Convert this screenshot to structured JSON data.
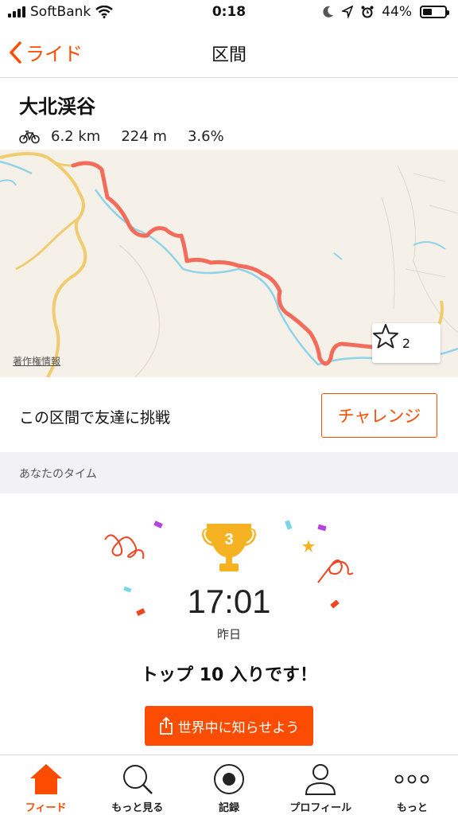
{
  "status_bar": {
    "carrier": "SoftBank",
    "time": "0:18",
    "battery_percent_text": "44%",
    "battery_level": 0.44
  },
  "nav": {
    "back_label": "ライド",
    "title": "区間"
  },
  "segment": {
    "name": "大北渓谷",
    "distance": "6.2 km",
    "elevation": "224 m",
    "grade": "3.6%",
    "activity_icon": "bicycle-icon"
  },
  "map": {
    "copyright": "著作権情報",
    "star_count": "2",
    "route_color": "#f26b5b",
    "road_color": "#f0cc6e",
    "river_color": "#8fd3ea"
  },
  "challenge": {
    "text": "この区間で友達に挑戦",
    "button_label": "チャレンジ"
  },
  "your_time": {
    "header": "あなたのタイム",
    "rank": "3",
    "time": "17:01",
    "date": "昨日",
    "message": "トップ 10 入りです！",
    "share_label": "世界中に知らせよう"
  },
  "tabs": [
    {
      "label": "フィード",
      "icon": "home-icon",
      "active": true
    },
    {
      "label": "もっと見る",
      "icon": "search-icon",
      "active": false
    },
    {
      "label": "記録",
      "icon": "record-icon",
      "active": false
    },
    {
      "label": "プロフィール",
      "icon": "profile-icon",
      "active": false
    },
    {
      "label": "もっと",
      "icon": "more-icon",
      "active": false
    }
  ],
  "colors": {
    "accent": "#fc4c02",
    "trophy_gold": "#f5b323"
  }
}
